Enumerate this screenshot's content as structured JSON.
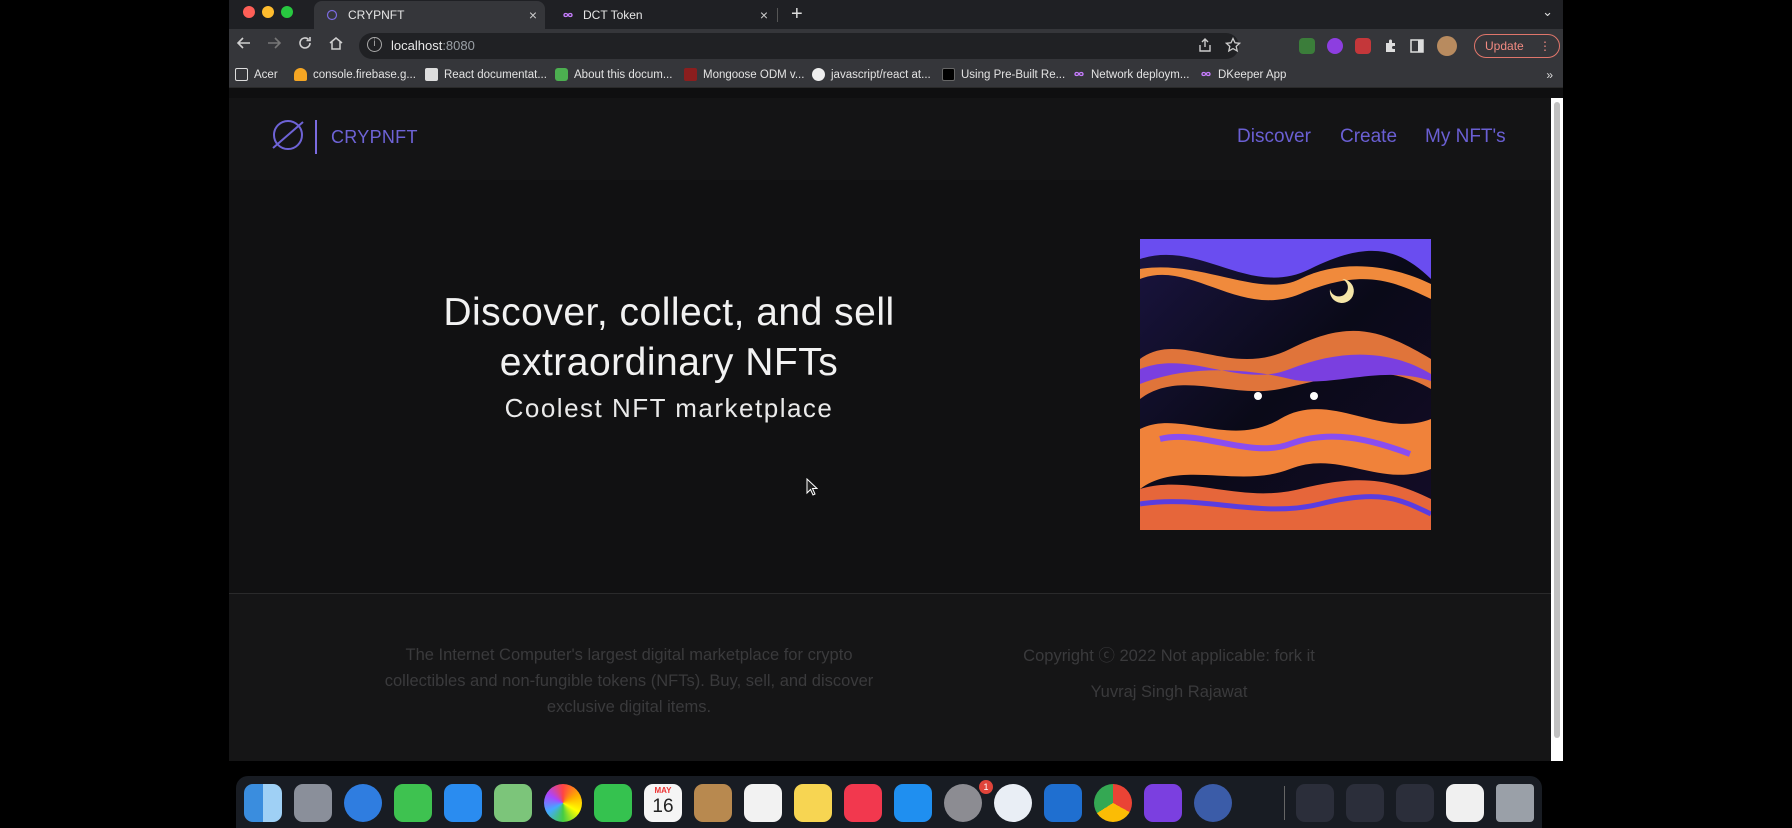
{
  "browser": {
    "tabs": [
      {
        "title": "CRYPNFT",
        "close": "×"
      },
      {
        "title": "DCT Token",
        "close": "×"
      }
    ],
    "new_tab": "+",
    "tab_menu": "⌄",
    "url_host": "localhost",
    "url_port": ":8080",
    "update_label": "Update",
    "update_menu": "⋮",
    "bookmarks": [
      "Acer",
      "console.firebase.g...",
      "React documentat...",
      "About this docum...",
      "Mongoose ODM v...",
      "javascript/react at...",
      "Using Pre-Built Re...",
      "Network deploym...",
      "DKeeper App"
    ],
    "bookmarks_more": "»"
  },
  "site": {
    "logo_text": "CRYPNFT",
    "nav": [
      "Discover",
      "Create",
      "My NFT's"
    ],
    "hero_title_line1": "Discover, collect, and sell",
    "hero_title_line2": "extraordinary NFTs",
    "hero_subtitle": "Coolest NFT marketplace",
    "footer_description": "The Internet Computer's largest digital marketplace for crypto collectibles and non-fungible tokens (NFTs). Buy, sell, and discover exclusive digital items.",
    "footer_copyright": "Copyright ⓒ 2022 Not applicable: fork it",
    "footer_author": "Yuvraj Singh Rajawat"
  },
  "dock": {
    "calendar_month": "MAY",
    "calendar_day": "16",
    "settings_badge": "1"
  },
  "colors": {
    "accent": "#6a5fd3",
    "page_bg": "#111112"
  }
}
